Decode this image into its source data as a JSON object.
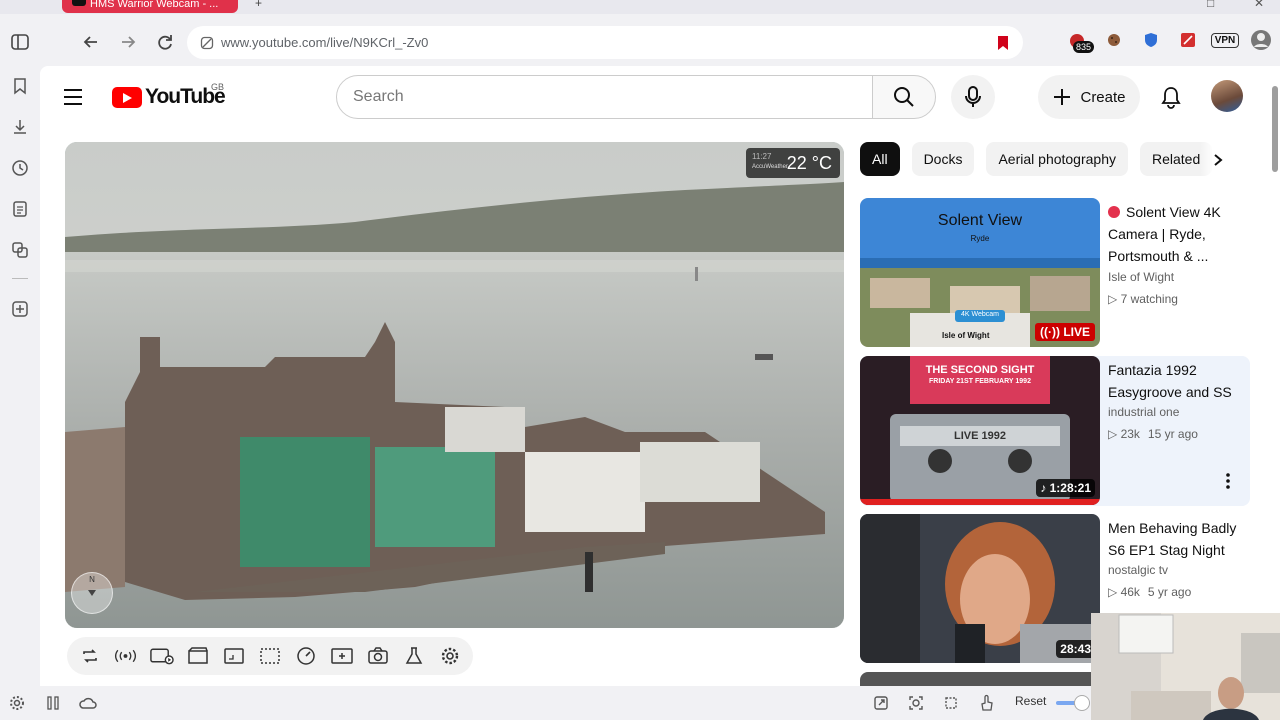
{
  "browser": {
    "tab_title": "HMS Warrior Webcam - ...",
    "url": "www.youtube.com/live/N9KCrl_-Zv0",
    "extension_badge": "835",
    "vpn_label": "VPN"
  },
  "youtube": {
    "region_code": "GB",
    "logo_text": "YouTube",
    "search_placeholder": "Search",
    "create_label": "Create"
  },
  "player": {
    "overlay_time": "11:27",
    "overlay_brand": "AccuWeather",
    "temperature": "22 °C",
    "compass_mark": "N"
  },
  "chips": [
    "All",
    "Docks",
    "Aerial photography",
    "Related"
  ],
  "recommendations": [
    {
      "title": "Solent View 4K Camera | Ryde, Portsmouth & ...",
      "channel": "Isle of Wight",
      "meta": "7 watching",
      "badge": "LIVE",
      "thumb_heading": "Solent View",
      "thumb_sub": "Ryde",
      "thumb_tag": "4K Webcam",
      "thumb_brand": "Isle of Wight"
    },
    {
      "title": "Fantazia 1992 Easygroove and SS",
      "channel": "industrial one",
      "views": "23k",
      "age": "15 yr ago",
      "duration": "1:28:21",
      "thumb_heading": "THE SECOND SIGHT",
      "thumb_sub": "FRIDAY 21ST FEBRUARY 1992",
      "thumb_tag": "LIVE 1992"
    },
    {
      "title": "Men Behaving Badly S6 EP1 Stag Night",
      "channel": "nostalgic tv",
      "views": "46k",
      "age": "5 yr ago",
      "duration": "28:43"
    }
  ],
  "bottom": {
    "reset_label": "Reset"
  }
}
